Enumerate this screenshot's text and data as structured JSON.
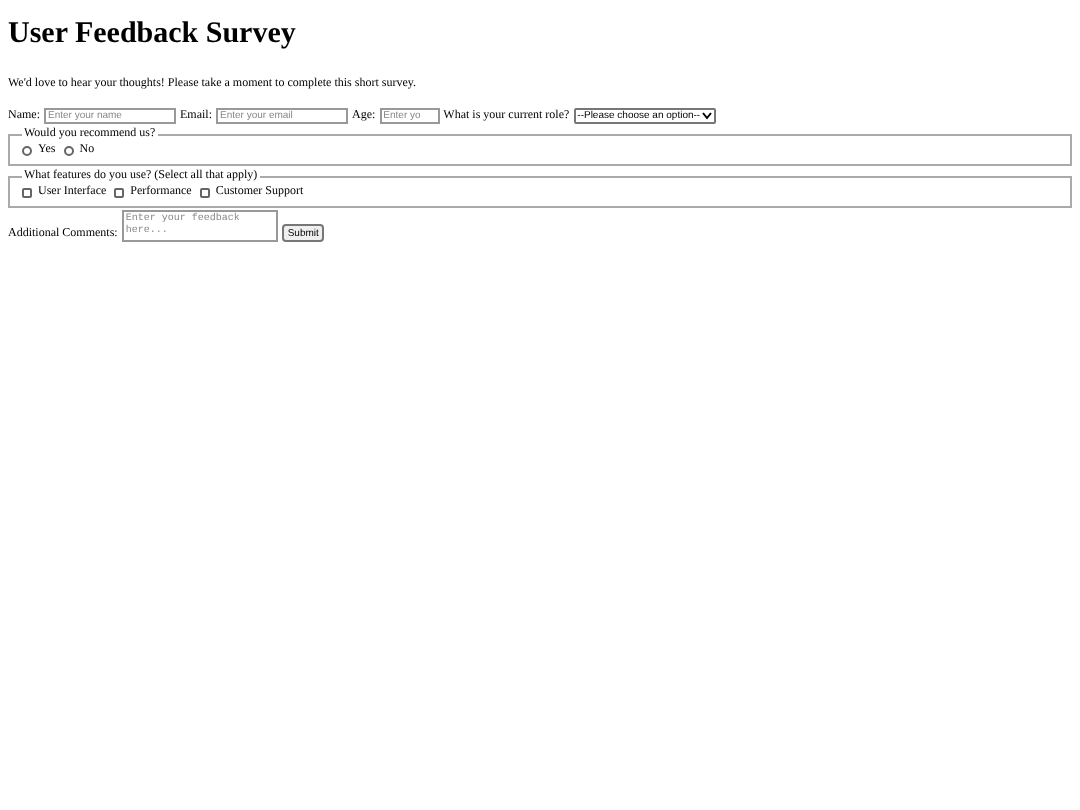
{
  "title": "User Feedback Survey",
  "intro": "We'd love to hear your thoughts! Please take a moment to complete this short survey.",
  "fields": [
    {
      "label": "Name:",
      "placeholder": "Enter your name"
    },
    {
      "label": "Email:",
      "placeholder": "Enter your email"
    },
    {
      "label": "Age:",
      "placeholder": "Enter yo"
    }
  ],
  "role": {
    "label": "What is your current role?",
    "value": "--Please choose an option--"
  },
  "recommend": {
    "legend": "Would you recommend us?",
    "options": [
      {
        "label": "Yes",
        "selected": false
      },
      {
        "label": "No",
        "selected": false
      }
    ]
  },
  "features": {
    "legend": "What features do you use? (Select all that apply)",
    "options": [
      {
        "label": "User Interface",
        "checked": false
      },
      {
        "label": "Performance",
        "checked": false
      },
      {
        "label": "Customer Support",
        "checked": false
      }
    ]
  },
  "comments": {
    "label": "Additional Comments:",
    "placeholder": "Enter your feedback here..."
  },
  "submit": "Submit"
}
